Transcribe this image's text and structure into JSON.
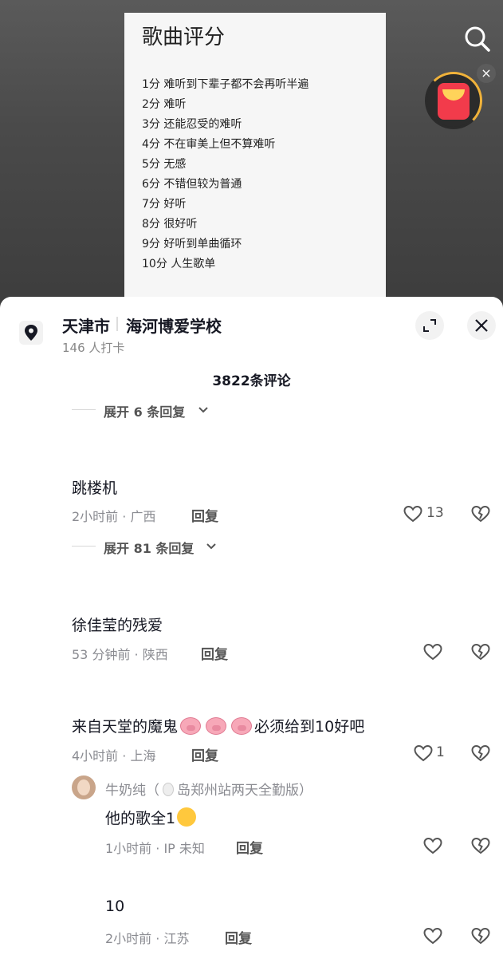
{
  "video": {
    "card_title": "歌曲评分",
    "ratings": [
      "1分 难听到下辈子都不会再听半遍",
      "2分 难听",
      "3分 还能忍受的难听",
      "4分 不在审美上但不算难听",
      "5分 无感",
      "6分 不错但较为普通",
      "7分 好听",
      "8分 很好听",
      "9分 好听到单曲循环",
      "10分 人生歌单"
    ],
    "close_symbol": "×"
  },
  "location": {
    "city": "天津市",
    "school": "海河博爱学校",
    "checkins": "146 人打卡"
  },
  "comments_header": {
    "count": "3822条评论"
  },
  "expand_top": {
    "label": "展开 6 条回复"
  },
  "comments": [
    {
      "text": "跳楼机",
      "meta": "2小时前 · 广西",
      "reply": "回复",
      "likes": "13",
      "expand": "展开 81 条回复"
    },
    {
      "text": "徐佳莹的残爱",
      "meta": "53 分钟前 · 陕西",
      "reply": "回复",
      "likes": ""
    },
    {
      "text_before": "来自天堂的魔鬼",
      "text_after": "必须给到10好吧",
      "meta": "4小时前 · 上海",
      "reply": "回复",
      "likes": "1",
      "sub_reply": {
        "user_before": "牛奶纯（",
        "user_after": "岛郑州站两天全勤版）",
        "text": "他的歌全1",
        "meta": "1小时前 · IP 未知",
        "reply": "回复"
      }
    },
    {
      "text": "10",
      "meta": "2小时前 · 江苏",
      "reply": "回复",
      "likes": ""
    }
  ]
}
